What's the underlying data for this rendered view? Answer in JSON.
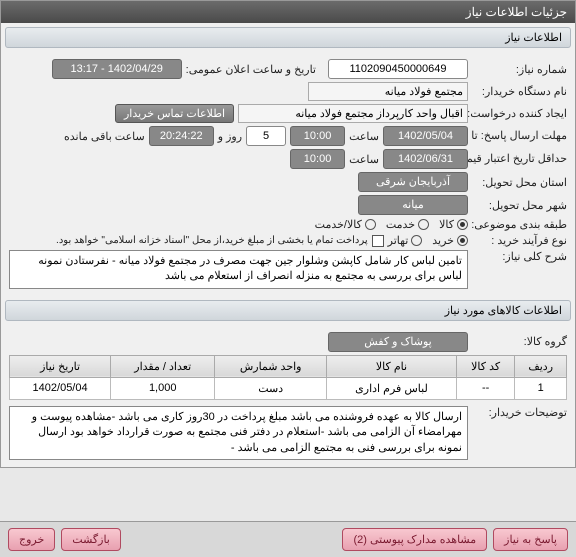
{
  "window": {
    "title": "جزئیات اطلاعات نیاز"
  },
  "section1": {
    "title": "اطلاعات نیاز"
  },
  "labels": {
    "need_no": "شماره نیاز:",
    "announce_dt": "تاریخ و ساعت اعلان عمومی:",
    "buyer_org": "نام دستگاه خریدار:",
    "requester": "ایجاد کننده درخواست:",
    "deadline": "مهلت ارسال پاسخ: تا تاریخ:",
    "hour": "ساعت",
    "day_and": "روز و",
    "remaining": "ساعت باقی مانده",
    "credit_deadline": "حداقل تاریخ اعتبار قیمت تا تاریخ:",
    "province": "استان محل تحویل:",
    "city": "شهر محل تحویل:",
    "category": "طبقه بندی موضوعی:",
    "process": "نوع فرآیند خرید :",
    "pay_note": "پرداخت تمام یا بخشی از مبلغ خرید،از محل \"اسناد خزانه اسلامی\" خواهد بود.",
    "desc_title": "شرح کلی نیاز:",
    "buyer_notes": "توضیحات خریدار:"
  },
  "values": {
    "need_no": "1102090450000649",
    "announce_dt": "1402/04/29 - 13:17",
    "buyer_org": "مجتمع فولاد میانه",
    "requester": "اقبال واحد کارپرداز مجتمع فولاد میانه",
    "deadline_date": "1402/05/04",
    "deadline_time": "10:00",
    "remain_days": "5",
    "remain_time": "20:24:22",
    "credit_date": "1402/06/31",
    "credit_time": "10:00",
    "province": "آذربایجان شرقی",
    "city": "میانه",
    "desc": "تامین لباس کار شامل کاپشن وشلوار جین جهت مصرف در مجتمع فولاد میانه - نفرستادن نمونه لباس برای بررسی به مجتمع به منزله انصراف از استعلام می باشد",
    "buyer_notes": "ارسال کالا به عهده فروشنده می باشد مبلغ پرداخت در 30روز کاری می باشد -مشاهده پیوست و مهرامضاء آن الزامی می باشد -استعلام در دفتر فنی مجتمع به صورت قرارداد خواهد بود ارسال نمونه برای بررسی فنی به مجتمع الزامی می باشد -"
  },
  "cat_options": {
    "goods": "کالا",
    "service": "خدمت",
    "goods_service": "کالا/خدمت"
  },
  "proc_options": {
    "buy": "خرید",
    "exchange": "تهاتر"
  },
  "buttons": {
    "contact": "اطلاعات تماس خریدار",
    "attachments": "مشاهده مدارک پیوستی (2)",
    "reply": "پاسخ به نیاز",
    "back": "بازگشت",
    "exit": "خروج"
  },
  "section2": {
    "title": "اطلاعات کالاهای مورد نیاز"
  },
  "goods_group_label": "گروه کالا:",
  "goods_group": "پوشاک و کفش",
  "table": {
    "headers": [
      "ردیف",
      "کد کالا",
      "نام کالا",
      "واحد شمارش",
      "تعداد / مقدار",
      "تاریخ نیاز"
    ],
    "rows": [
      {
        "no": "1",
        "code": "--",
        "name": "لباس فرم اداری",
        "unit": "دست",
        "qty": "1,000",
        "date": "1402/05/04"
      }
    ]
  }
}
